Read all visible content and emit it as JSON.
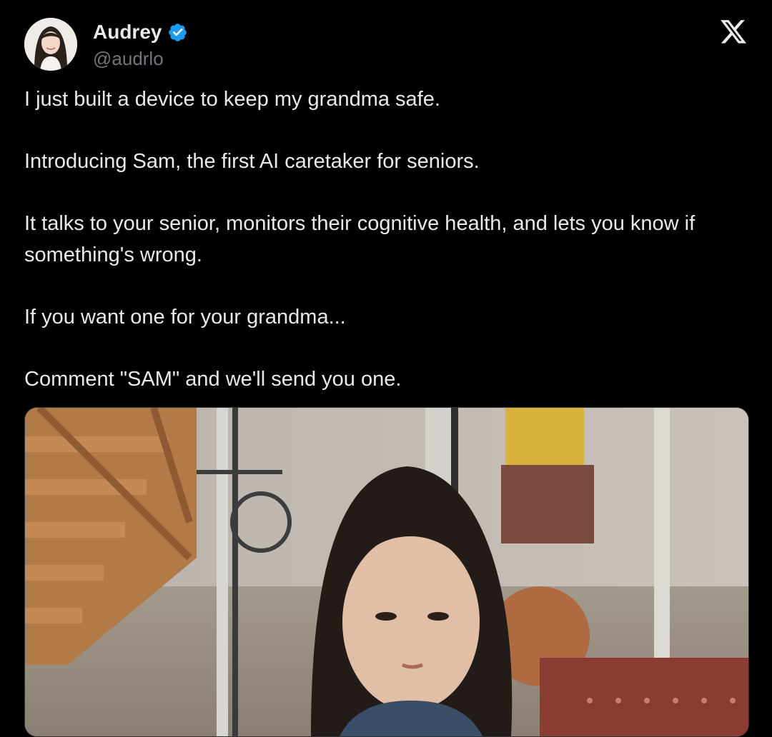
{
  "author": {
    "display_name": "Audrey",
    "handle": "@audrlo",
    "verified": true,
    "avatar_icon": "profile-photo"
  },
  "platform_logo": "x-logo-icon",
  "tweet": {
    "paragraphs": [
      "I just built a device to keep my grandma safe.",
      "Introducing Sam, the first AI caretaker for seniors.",
      "It talks to your senior, monitors their cognitive health, and lets you know if something's wrong.",
      "If you want one for your grandma...",
      "Comment \"SAM\" and we'll send you one."
    ]
  },
  "media": {
    "kind": "video-thumbnail"
  },
  "colors": {
    "background": "#000000",
    "text": "#e7e9ea",
    "secondary_text": "#71767b",
    "verified_badge": "#1d9bf0"
  }
}
